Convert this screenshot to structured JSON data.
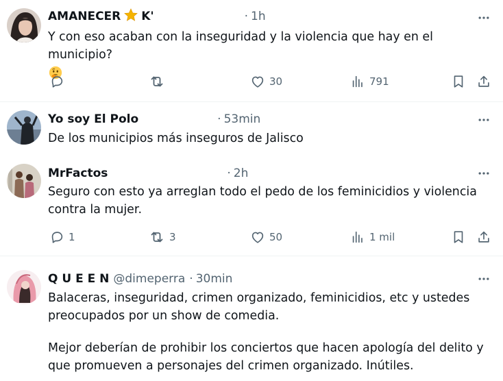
{
  "tweets": [
    {
      "name": "AMANECER",
      "name_suffix": "K'",
      "time": "1h",
      "text_line1": "Y con eso acaban con la inseguridad y la violencia que hay en el municipio?",
      "emoji": "thinking-face",
      "reply_count": "",
      "retweet_count": "",
      "like_count": "30",
      "view_count": "791"
    },
    {
      "name": "Yo soy El Polo",
      "time": "53min",
      "text_line1": "De los municipios más inseguros de Jalisco"
    },
    {
      "name": "MrFactos",
      "time": "2h",
      "text_line1": "Seguro con esto ya arreglan todo el pedo de los feminicidios y violencia",
      "text_line2": "contra la mujer.",
      "reply_count": "1",
      "retweet_count": "3",
      "like_count": "50",
      "view_count": "1 mil"
    },
    {
      "name": "Q U E E N",
      "handle": "@dimeperra",
      "time": "30min",
      "text_line1": "Balaceras, inseguridad, crimen organizado, feminicidios, etc y ustedes",
      "text_line2": "preocupados por un show de comedia.",
      "text_line3": "Mejor deberían de prohibir los conciertos que hacen apología del delito y",
      "text_line4": "que promueven a personajes del crimen organizado. Inútiles."
    }
  ],
  "colors": {
    "text": "#0f1419",
    "secondary": "#536471",
    "divider": "#eff3f4",
    "star": "#f5b400"
  },
  "icons": [
    "reply-icon",
    "retweet-icon",
    "like-icon",
    "views-icon",
    "bookmark-icon",
    "share-icon",
    "more-icon",
    "star-icon"
  ]
}
